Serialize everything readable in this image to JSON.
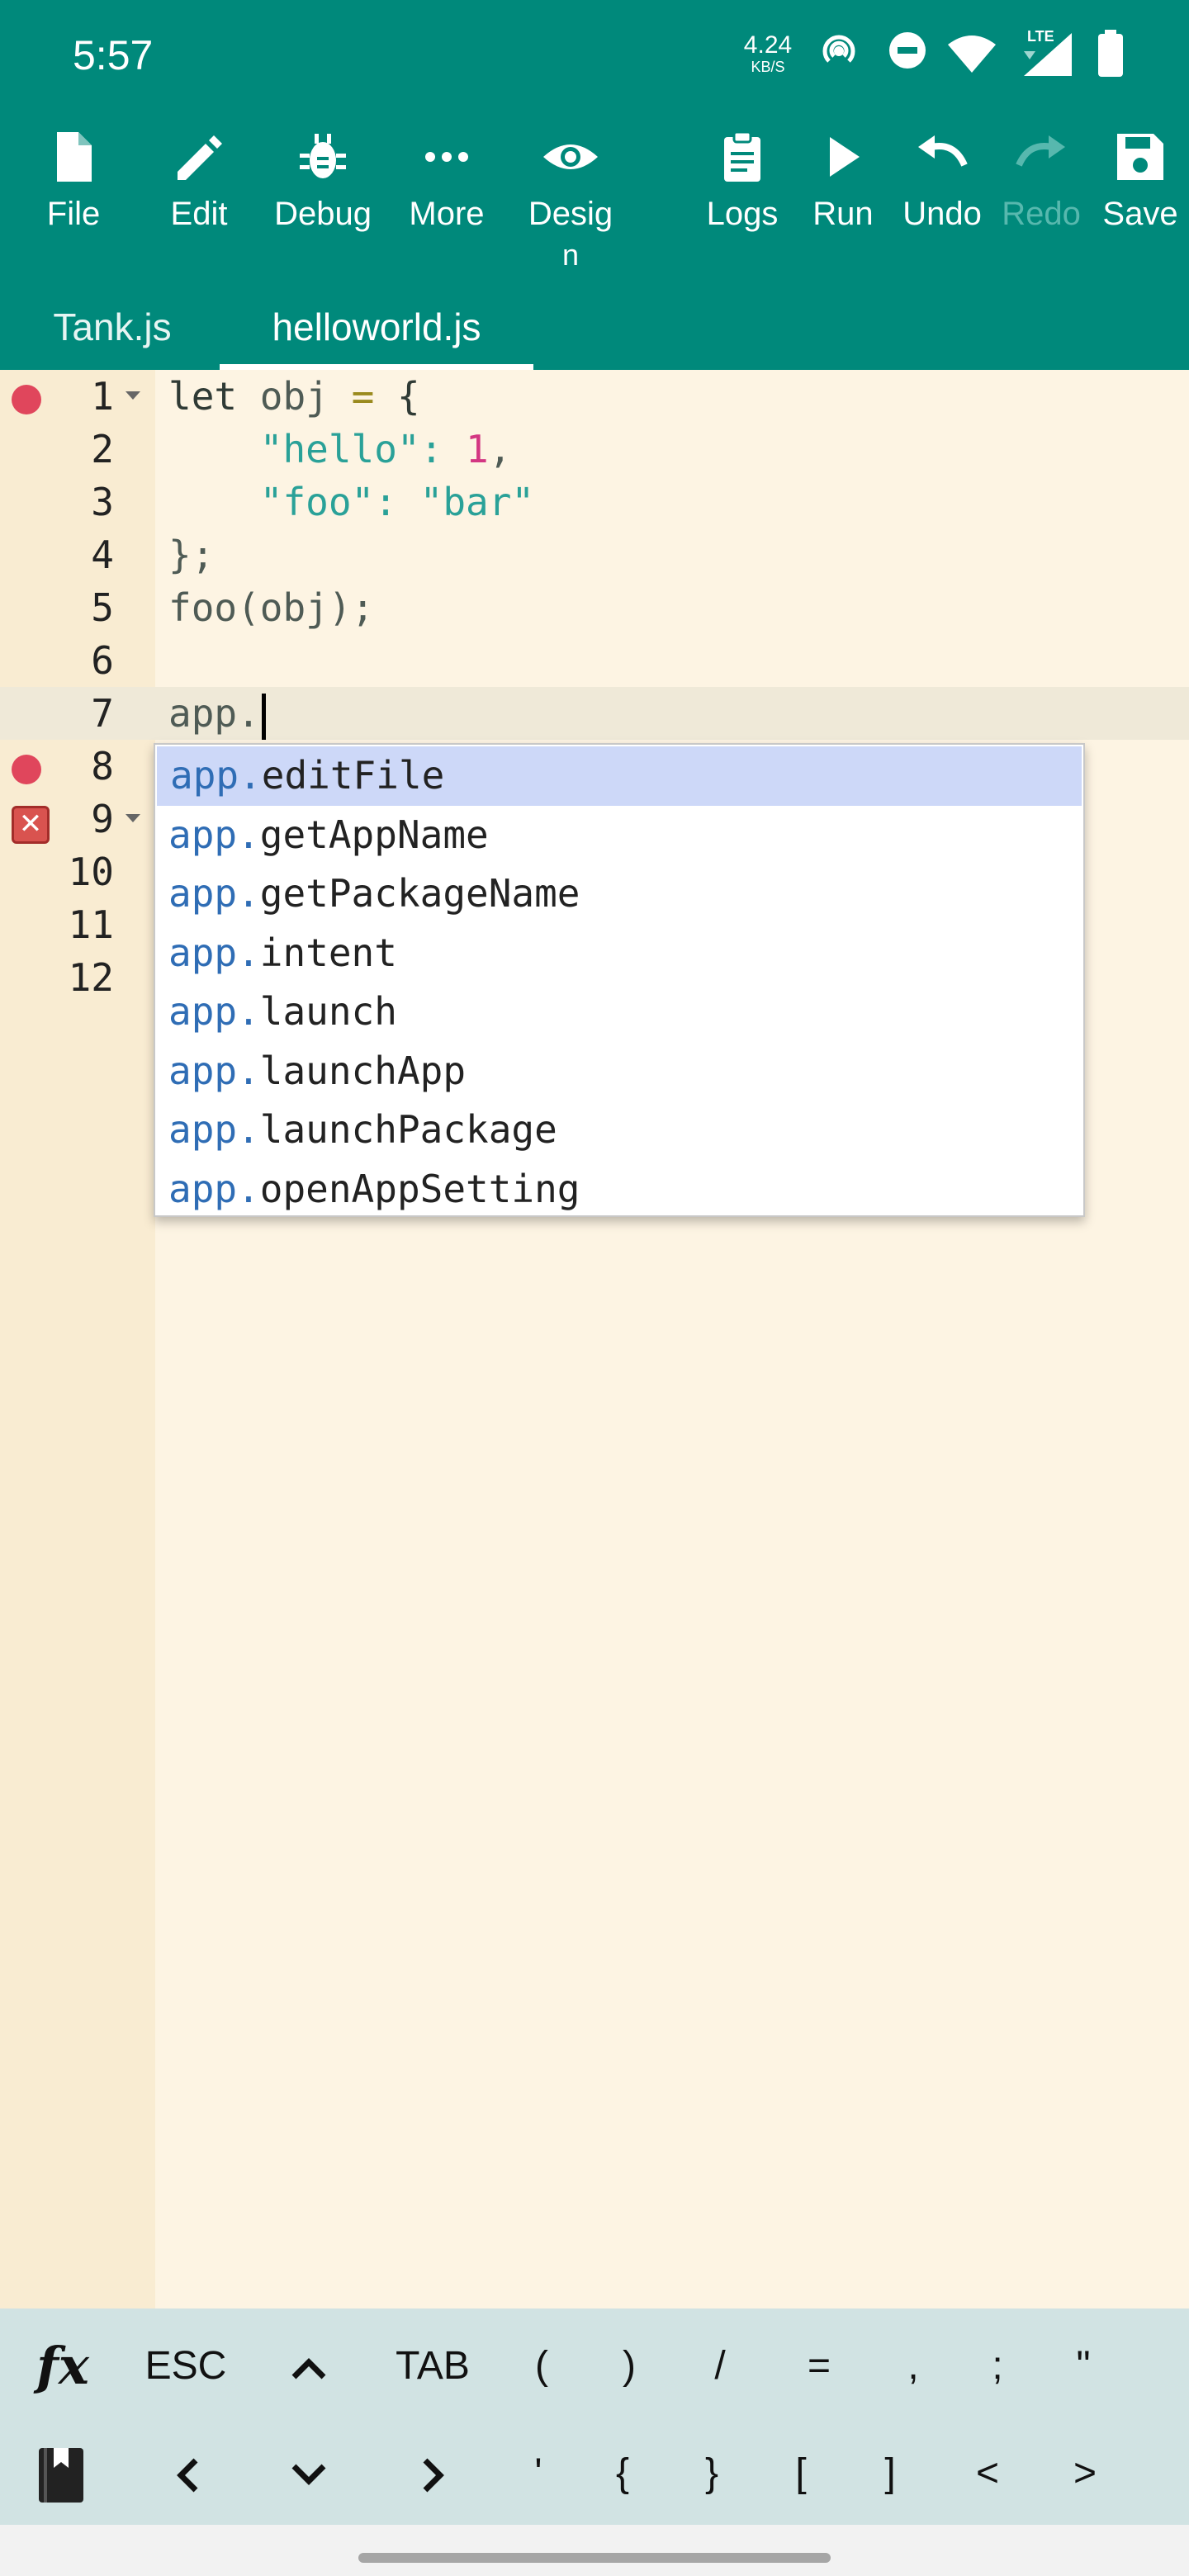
{
  "status": {
    "time": "5:57",
    "net_speed_value": "4.24",
    "net_speed_unit": "KB/S",
    "lte_label": "LTE"
  },
  "toolbar": {
    "file": "File",
    "edit": "Edit",
    "debug": "Debug",
    "more": "More",
    "design_line1": "Desig",
    "design_line2": "n",
    "logs": "Logs",
    "run": "Run",
    "undo": "Undo",
    "redo": "Redo",
    "save": "Save"
  },
  "tabs": [
    "Tank.js",
    "helloworld.js"
  ],
  "active_tab": "helloworld.js",
  "editor": {
    "line_numbers": [
      "1",
      "2",
      "3",
      "4",
      "5",
      "6",
      "7",
      "8",
      "9",
      "10",
      "11",
      "12"
    ],
    "code": {
      "l1_kw": "let",
      "l1_var": " obj ",
      "l1_eq": "=",
      "l1_brace": " {",
      "l2_key": "\"hello\"",
      "l2_colon": ": ",
      "l2_num": "1",
      "l2_comma": ",",
      "l3_key": "\"foo\"",
      "l3_colon": ": ",
      "l3_val": "\"bar\"",
      "l4": "};",
      "l5": "foo(obj);",
      "l7": "app."
    }
  },
  "autocomplete": {
    "prefix": "app.",
    "items": [
      "editFile",
      "getAppName",
      "getPackageName",
      "intent",
      "launch",
      "launchApp",
      "launchPackage",
      "openAppSetting"
    ],
    "selected": "editFile"
  },
  "keys": {
    "row1": [
      "ESC",
      "TAB",
      "(",
      ")",
      "/",
      "=",
      ",",
      ";",
      "\""
    ],
    "row2": [
      "'",
      "{",
      "}",
      "[",
      "]",
      "<",
      ">"
    ],
    "fx": "fx"
  },
  "colors": {
    "accent": "#00897b",
    "editor_bg": "#fdf4e3",
    "keybar_bg": "#d1e3e3"
  }
}
